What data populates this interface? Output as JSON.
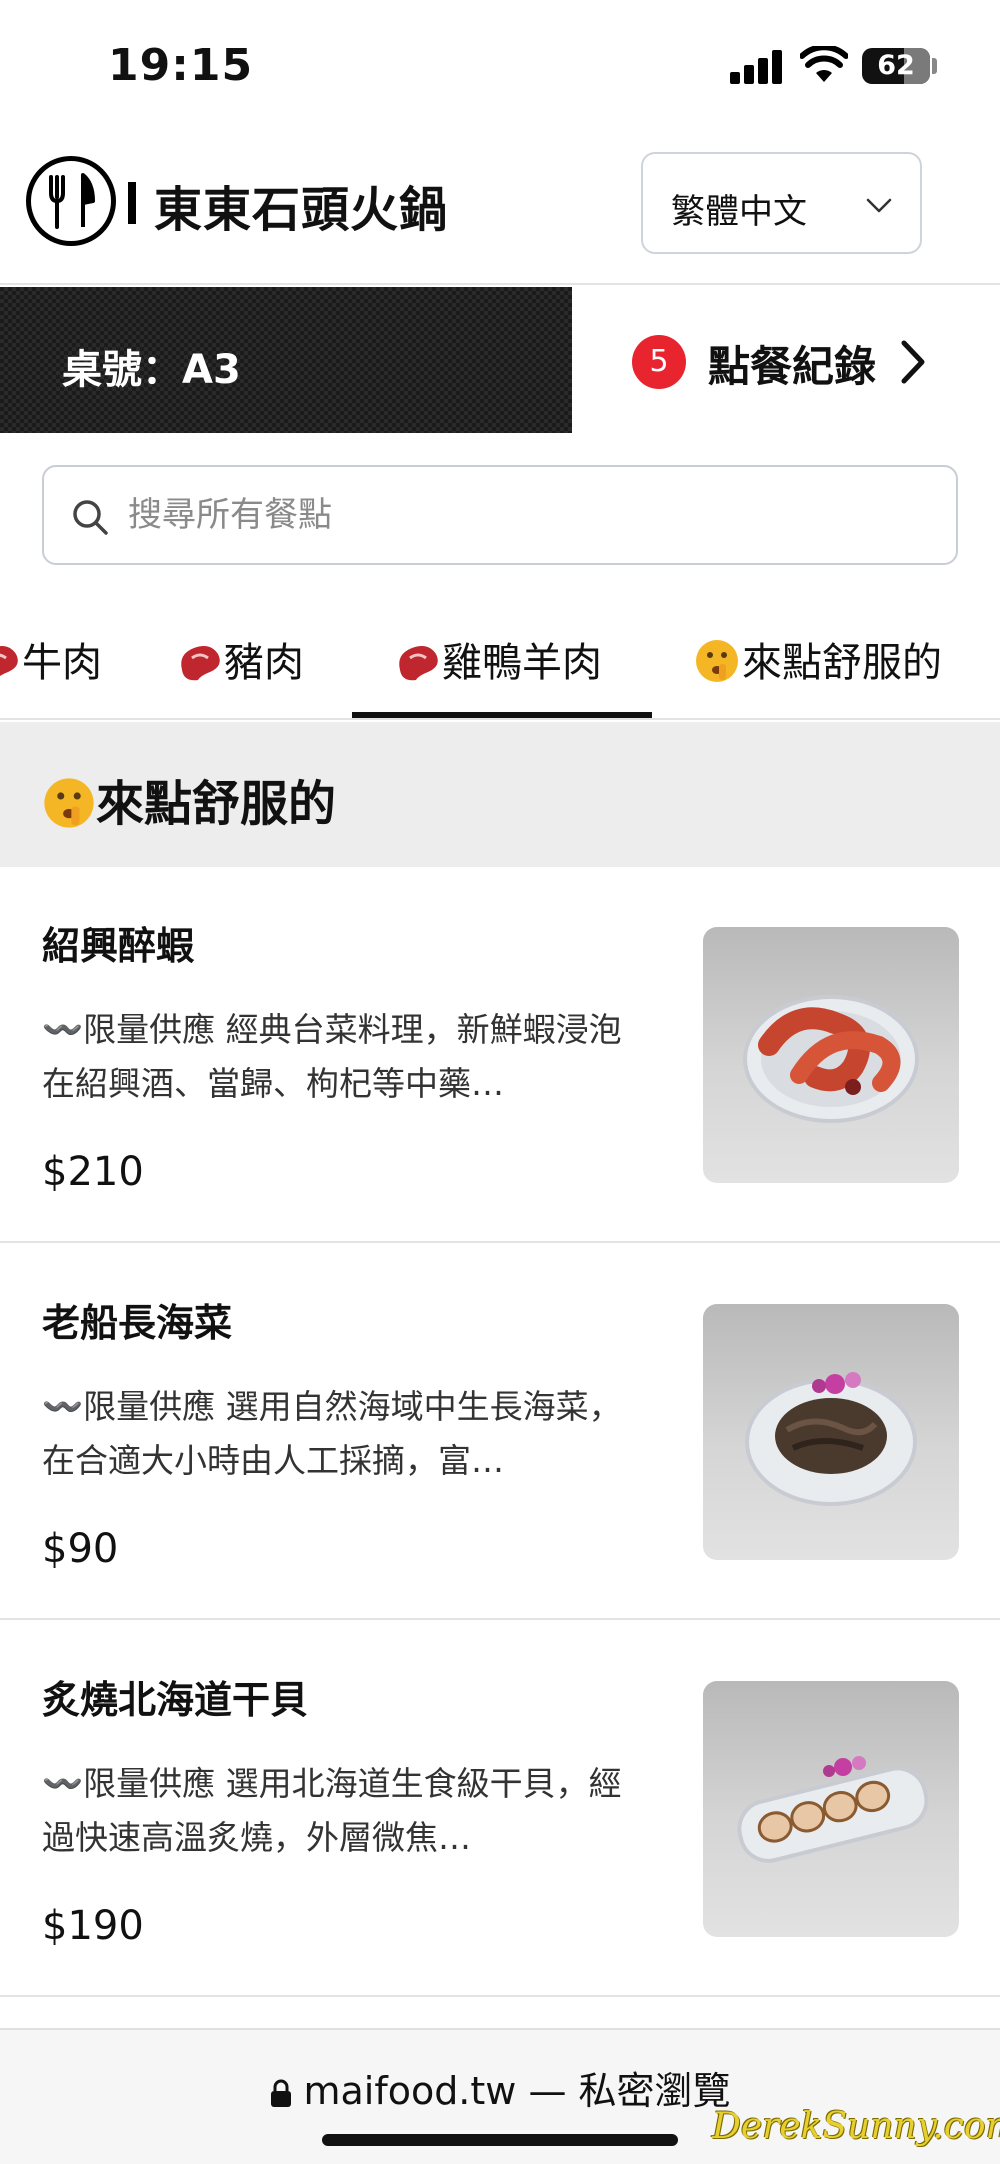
{
  "status_bar": {
    "time": "19:15",
    "battery": "62"
  },
  "header": {
    "brand": "東東石頭火鍋",
    "language": "繁體中文"
  },
  "table_bar": {
    "table_number": "桌號：A3",
    "order_count": "5",
    "order_label": "點餐紀錄"
  },
  "search": {
    "placeholder": "搜尋所有餐點"
  },
  "tabs": [
    {
      "label": "牛肉",
      "icon": "meat-icon"
    },
    {
      "label": "豬肉",
      "icon": "meat-icon"
    },
    {
      "label": "雞鴨羊肉",
      "icon": "meat-icon",
      "active": true
    },
    {
      "label": "來點舒服的",
      "icon": "shushing-face-icon"
    }
  ],
  "section": {
    "title": "來點舒服的",
    "icon": "shushing-face-icon"
  },
  "items": [
    {
      "name": "紹興醉蝦",
      "description": "〰️限量供應 經典台菜料理，新鮮蝦浸泡在紹興酒、當歸、枸杞等中藥…",
      "price": "$210",
      "image": "drunken-shrimp-photo"
    },
    {
      "name": "老船長海菜",
      "description": "〰️限量供應 選用自然海域中生長海菜，在合適大小時由人工採摘，富…",
      "price": "$90",
      "image": "seaweed-photo"
    },
    {
      "name": "炙燒北海道干貝",
      "description": "〰️限量供應 選用北海道生食級干貝，經過快速高溫炙燒，外層微焦…",
      "price": "$190",
      "image": "seared-scallop-photo"
    }
  ],
  "browser": {
    "url": "maifood.tw — 私密瀏覽"
  },
  "watermark": "DerekSunny.com",
  "colors": {
    "badge": "#e8242f",
    "section_bg": "#ededed",
    "table_bar_bg": "#1b1b1b"
  }
}
